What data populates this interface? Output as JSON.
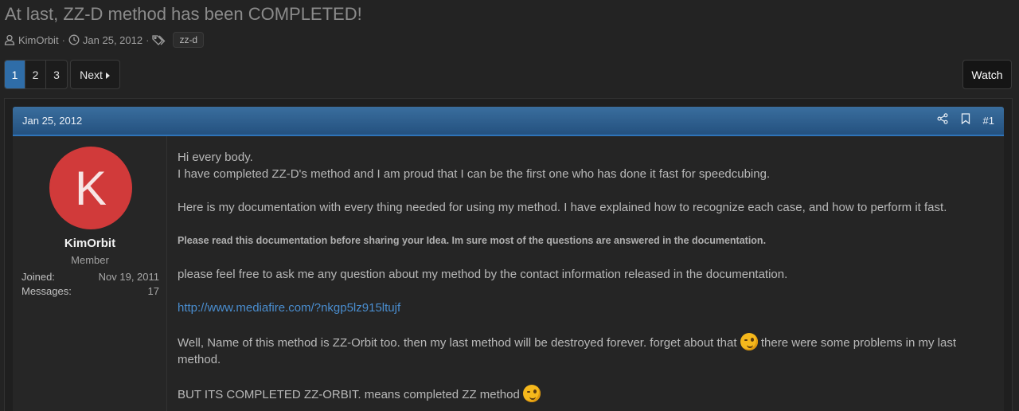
{
  "thread": {
    "title": "At last, ZZ-D method has been COMPLETED!",
    "author": "KimOrbit",
    "date": "Jan 25, 2012",
    "tag": "zz-d",
    "meta_sep": "·"
  },
  "pagination": {
    "pages": [
      "1",
      "2",
      "3"
    ],
    "active_page": "1",
    "next_label": "Next",
    "watch_label": "Watch"
  },
  "post": {
    "date": "Jan 25, 2012",
    "number": "#1",
    "user": {
      "avatar_letter": "K",
      "avatar_color": "#d13a3a",
      "name": "KimOrbit",
      "role": "Member",
      "joined_label": "Joined:",
      "joined_value": "Nov 19, 2011",
      "messages_label": "Messages:",
      "messages_value": "17"
    },
    "body": {
      "line1": "Hi every body.",
      "line2": "I have completed ZZ-D's method and I am proud that I can be the first one who has done it fast for speedcubing.",
      "line3": "Here is my documentation with every thing needed for using my method. I have explained how to recognize each case, and how to perform it fast.",
      "line4": "Please read this documentation before sharing your Idea. Im sure most of the questions are answered in the documentation.",
      "line5": "please feel free to ask me any question about my method by the contact information released in the documentation.",
      "link": "http://www.mediafire.com/?nkgp5lz915ltujf",
      "line6a": "Well, Name of this method is ZZ-Orbit too. then my last method will be destroyed forever. forget about that",
      "line6b": "there were some problems in my last method.",
      "line7": "BUT ITS COMPLETED ZZ-ORBIT. means completed ZZ method"
    }
  },
  "colors": {
    "accent": "#2f6da8",
    "header_gradient_top": "#3a6e9e",
    "link": "#4a8ed0"
  },
  "icons": [
    "user-icon",
    "clock-icon",
    "tag-icon",
    "caret-right-icon",
    "share-icon",
    "bookmark-icon",
    "wink-emoji-icon"
  ]
}
